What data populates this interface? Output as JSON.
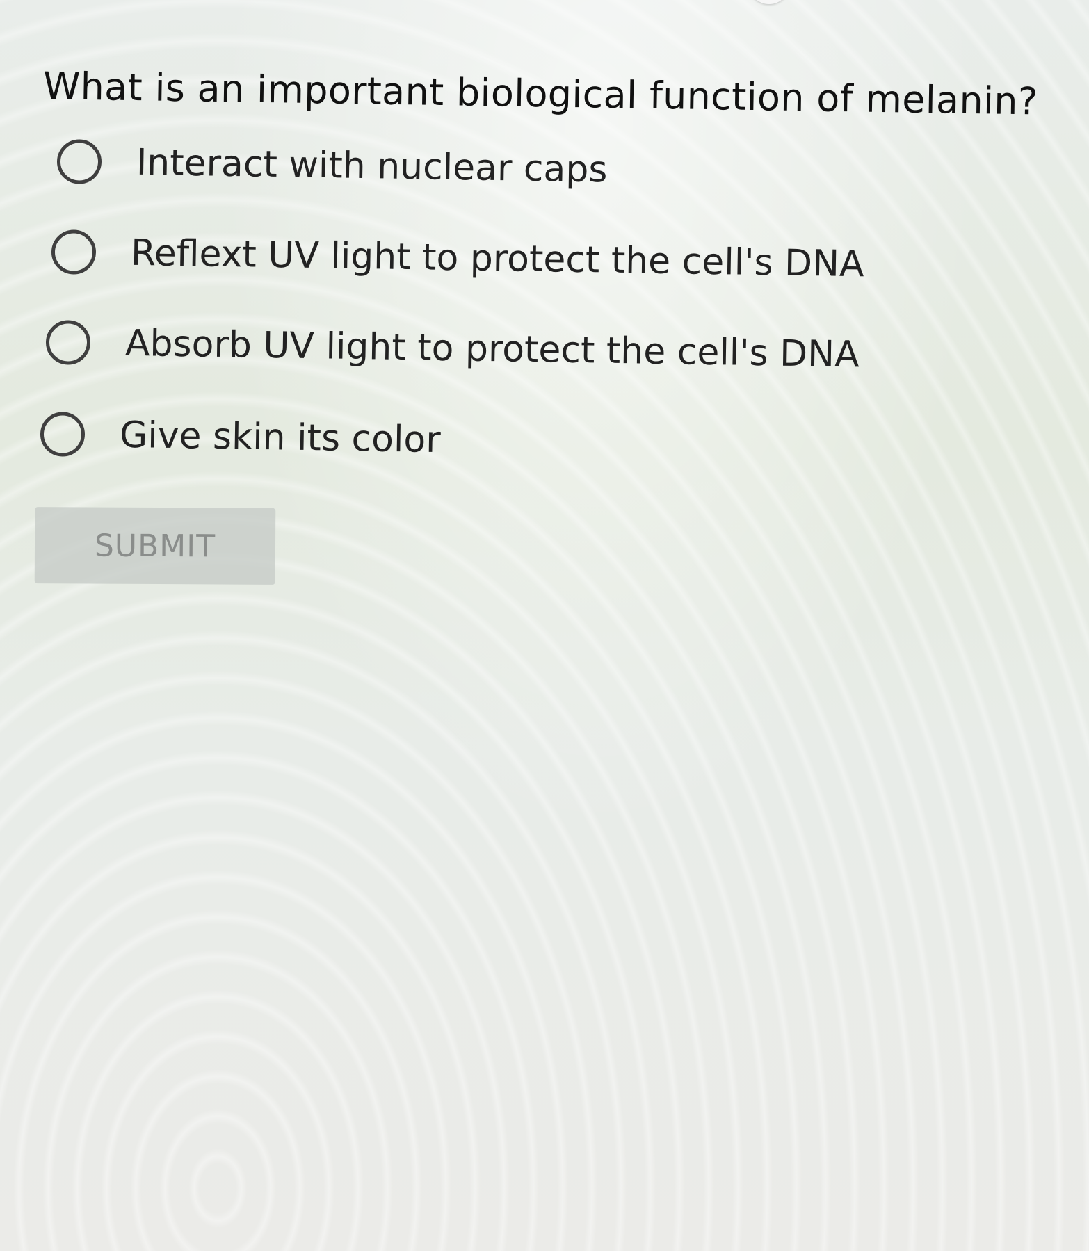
{
  "question": {
    "text": "What is an important biological function of melanin?"
  },
  "options": [
    {
      "label": "Interact with nuclear caps",
      "selected": false
    },
    {
      "label": "Reflext UV light to protect the cell's DNA",
      "selected": false
    },
    {
      "label": "Absorb UV light to protect the cell's DNA",
      "selected": false
    },
    {
      "label": "Give skin its color",
      "selected": false
    }
  ],
  "submit": {
    "label": "SUBMIT",
    "enabled": false
  },
  "colors": {
    "text": "#111111",
    "radio_border": "#3f3f3f",
    "submit_bg": "#c4cac6",
    "submit_text": "#8a8d8b"
  }
}
